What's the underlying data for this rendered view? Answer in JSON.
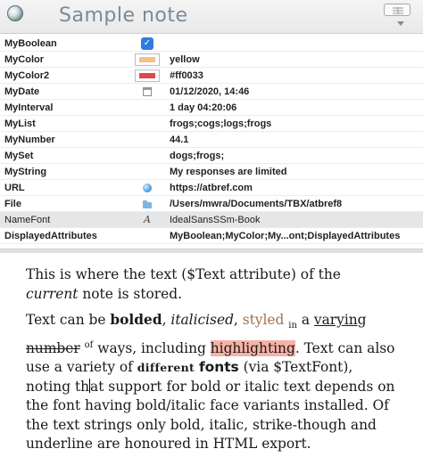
{
  "window": {
    "title": "Sample note"
  },
  "attributes": [
    {
      "name": "MyBoolean",
      "icon": "checkbox-icon",
      "value": ""
    },
    {
      "name": "MyColor",
      "icon": "color-swatch-icon",
      "swatch": "#f3c08b",
      "value": "yellow"
    },
    {
      "name": "MyColor2",
      "icon": "color-swatch-icon",
      "swatch": "#e04848",
      "value": "#ff0033"
    },
    {
      "name": "MyDate",
      "icon": "calendar-icon",
      "value": "01/12/2020, 14:46"
    },
    {
      "name": "MyInterval",
      "icon": "",
      "value": "1 day 04:20:06"
    },
    {
      "name": "MyList",
      "icon": "",
      "value": "frogs;cogs;logs;frogs"
    },
    {
      "name": "MyNumber",
      "icon": "",
      "value": "44.1"
    },
    {
      "name": "MySet",
      "icon": "",
      "value": "dogs;frogs;"
    },
    {
      "name": "MyString",
      "icon": "",
      "value": "My responses are limited"
    },
    {
      "name": "URL",
      "icon": "globe-icon",
      "value": "https://atbref.com"
    },
    {
      "name": "File",
      "icon": "folder-icon",
      "value": "/Users/mwra/Documents/TBX/atbref8"
    },
    {
      "name": "NameFont",
      "icon": "font-icon",
      "icon_glyph": "A",
      "value": "IdealSansSSm-Book"
    },
    {
      "name": "DisplayedAttributes",
      "icon": "",
      "value": "MyBoolean;MyColor;My...ont;DisplayedAttributes"
    }
  ],
  "text": {
    "p1_a": "This is where the text ($Text attribute) of the ",
    "p1_current": "current",
    "p1_b": " note is stored.",
    "p2_a": "Text can be ",
    "p2_bolded": "bolded",
    "p2_comma1": ", ",
    "p2_italicised": "italicised",
    "p2_comma2": ", ",
    "p2_styled": "styled",
    "p2_sp1": " ",
    "p2_in": "in",
    "p2_a2": " a ",
    "p2_varying": "varying",
    "p2_sp2": " ",
    "p2_number": "number",
    "p2_sp3": " ",
    "p2_of": "of",
    "p2_b": " ways, including ",
    "p2_highlighting": "highlighting",
    "p2_c": ". Text can also use a variety of ",
    "p2_different": "different",
    "p2_sp4": " ",
    "p2_fonts": "fonts",
    "p2_d1": " (via $TextFont), noting th",
    "p2_d2": "at support for bold or italic text depends on the font having bold/italic face variants installed. Of the text strings only bold, italic, strike-though and underline are honoured in HTML export."
  }
}
